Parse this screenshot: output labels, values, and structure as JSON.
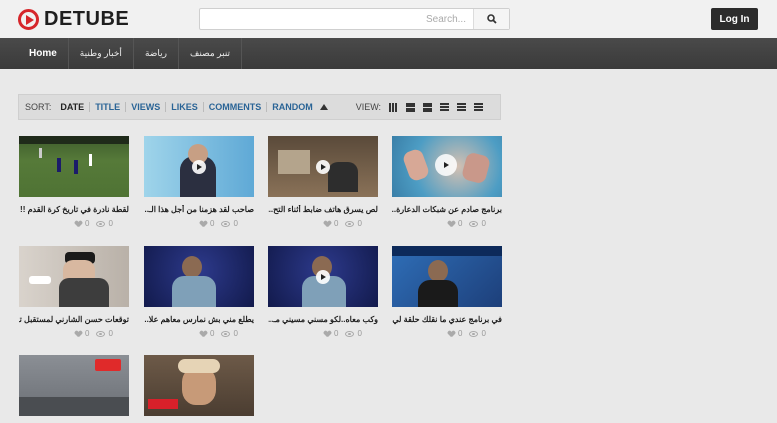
{
  "brand": {
    "name": "DETUBE"
  },
  "search": {
    "placeholder": "Search..."
  },
  "header": {
    "login_label": "Log In"
  },
  "nav": {
    "items": [
      "Home",
      "أخبار وطنية",
      "رياضة",
      "تنبر مصنف"
    ]
  },
  "sortbar": {
    "sort_label": "SORT:",
    "options": [
      "DATE",
      "TITLE",
      "VIEWS",
      "LIKES",
      "COMMENTS",
      "RANDOM"
    ],
    "active": "DATE",
    "view_label": "VIEW:"
  },
  "videos": [
    {
      "title": "لقطة نادرة في تاريخ كرة القدم !! ...",
      "likes": "0",
      "views": "0"
    },
    {
      "title": "صاحب لقد هزمنا من أجل هذا الـ...",
      "likes": "0",
      "views": "0"
    },
    {
      "title": "لص يسرق هاتف ضابط أثناء التح...",
      "likes": "0",
      "views": "0"
    },
    {
      "title": "برنامج صادم عن شبكات الدعارة...",
      "likes": "0",
      "views": "0"
    },
    {
      "title": "توقعات حسن الشارني لمستقبل تو...",
      "likes": "0",
      "views": "0"
    },
    {
      "title": "يطلع مني بش نمارس معاهم علا...",
      "likes": "0",
      "views": "0"
    },
    {
      "title": "وكب معاه..لكو مسني مسيني مـ...",
      "likes": "0",
      "views": "0"
    },
    {
      "title": "في برنامج عندي ما نقلك حلقة لي...",
      "likes": "0",
      "views": "0"
    },
    {
      "title": "",
      "likes": "",
      "views": ""
    },
    {
      "title": "",
      "likes": "",
      "views": ""
    }
  ],
  "colors": {
    "brand_red": "#d6262b",
    "nav_dark": "#3a3a3a",
    "link_blue": "#2a6496"
  }
}
